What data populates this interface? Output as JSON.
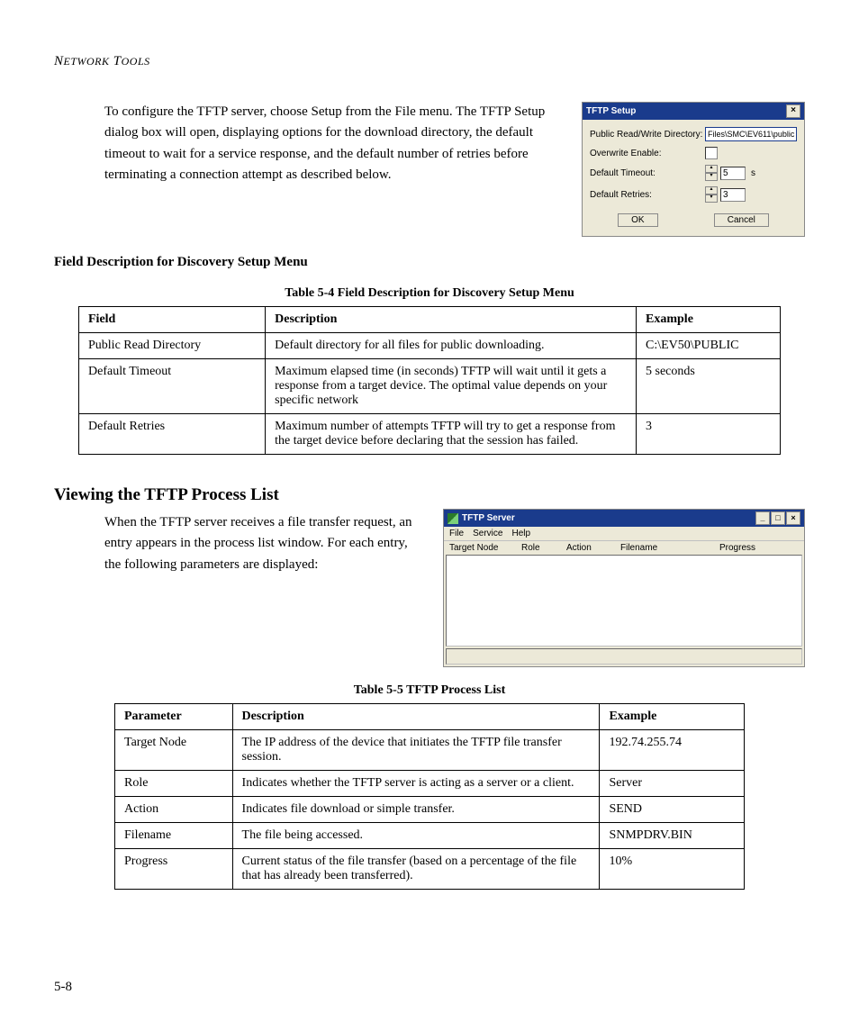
{
  "header": "NETWORK TOOLS",
  "intro": "To configure the TFTP server, choose Setup from the File menu. The TFTP Setup dialog box will open, displaying options for the download directory, the default timeout to wait for a service response, and the default number of retries before terminating a connection attempt as described below.",
  "dialog": {
    "title": "TFTP Setup",
    "rows": {
      "dir_label": "Public Read/Write Directory:",
      "dir_value": "Files\\SMC\\EV611\\public",
      "overwrite_label": "Overwrite Enable:",
      "timeout_label": "Default Timeout:",
      "timeout_value": "5",
      "timeout_unit": "s",
      "retries_label": "Default Retries:",
      "retries_value": "3"
    },
    "ok": "OK",
    "cancel": "Cancel"
  },
  "section1_heading": "Field Description for Discovery Setup Menu",
  "table1": {
    "caption": "Table 5-4  Field Description for Discovery Setup Menu",
    "head": [
      "Field",
      "Description",
      "Example"
    ],
    "rows": [
      [
        "Public Read Directory",
        "Default directory for all files for public downloading.",
        "C:\\EV50\\PUBLIC"
      ],
      [
        "Default Timeout",
        "Maximum elapsed time (in seconds) TFTP will wait until it gets a response from a target device. The optimal value depends on your specific network",
        "5 seconds"
      ],
      [
        "Default Retries",
        "Maximum number of attempts TFTP will try to get a response from the target device before declaring that the session has failed.",
        "3"
      ]
    ]
  },
  "h2": "Viewing the TFTP Process List",
  "process_text": "When the TFTP server receives a file transfer request, an entry appears in the process list window. For each entry, the following parameters are displayed:",
  "tftp_window": {
    "title": "TFTP Server",
    "menu": [
      "File",
      "Service",
      "Help"
    ],
    "cols": [
      "Target Node",
      "Role",
      "Action",
      "Filename",
      "Progress"
    ]
  },
  "table2": {
    "caption": "Table 5-5  TFTP Process List",
    "head": [
      "Parameter",
      "Description",
      "Example"
    ],
    "rows": [
      [
        "Target Node",
        "The IP address of the device that initiates the TFTP file transfer session.",
        "192.74.255.74"
      ],
      [
        "Role",
        "Indicates whether the TFTP server is acting as a server or a client.",
        "Server"
      ],
      [
        "Action",
        "Indicates file download or simple transfer.",
        "SEND"
      ],
      [
        "Filename",
        "The file being accessed.",
        "SNMPDRV.BIN"
      ],
      [
        "Progress",
        "Current status of the file transfer (based on a percentage of the file that has already been transferred).",
        "10%"
      ]
    ]
  },
  "pagenum": "5-8"
}
